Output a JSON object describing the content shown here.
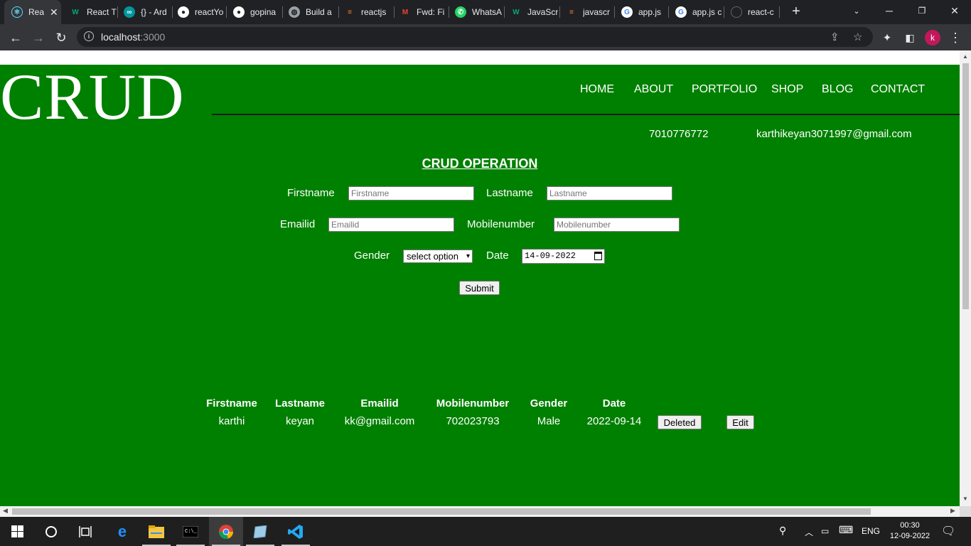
{
  "browser": {
    "tabs": [
      {
        "title": "Rea",
        "icon": "react-icon",
        "color": "#61dafb"
      },
      {
        "title": "React T",
        "icon": "w3schools-icon",
        "color": "#04aa6d"
      },
      {
        "title": "{} - Ard",
        "icon": "arduino-icon",
        "color": "#00979c"
      },
      {
        "title": "reactYo",
        "icon": "github-icon",
        "color": "#ffffff"
      },
      {
        "title": "gopina",
        "icon": "github-icon",
        "color": "#ffffff"
      },
      {
        "title": "Build a",
        "icon": "globe-icon",
        "color": "#9aa0a6"
      },
      {
        "title": "reactjs",
        "icon": "stackoverflow-icon",
        "color": "#f48024"
      },
      {
        "title": "Fwd: Fi",
        "icon": "gmail-icon",
        "color": "#ea4335"
      },
      {
        "title": "WhatsA",
        "icon": "whatsapp-icon",
        "color": "#25d366"
      },
      {
        "title": "JavaScr",
        "icon": "w3schools-icon",
        "color": "#04aa6d"
      },
      {
        "title": "javascr",
        "icon": "stackoverflow-icon",
        "color": "#f48024"
      },
      {
        "title": "app.js",
        "icon": "google-icon",
        "color": "#4285f4"
      },
      {
        "title": "app.js c",
        "icon": "google-icon",
        "color": "#4285f4"
      },
      {
        "title": "react-c",
        "icon": "loading-icon",
        "color": "#5f6368"
      }
    ],
    "url_host": "localhost",
    "url_port": ":3000",
    "profile_initial": "k"
  },
  "site": {
    "logo": "CRUD",
    "nav": [
      "HOME",
      "ABOUT",
      "PORTFOLIO",
      "SHOP",
      "BLOG",
      "CONTACT"
    ],
    "phone": "7010776772",
    "email": "karthikeyan3071997@gmail.com"
  },
  "form": {
    "heading": "CRUD OPERATION",
    "firstname_label": "Firstname",
    "firstname_placeholder": "Firstname",
    "lastname_label": "Lastname",
    "lastname_placeholder": "Lastname",
    "emailid_label": "Emailid",
    "emailid_placeholder": "Emailid",
    "mobile_label": "Mobilenumber",
    "mobile_placeholder": "Mobilenumber",
    "gender_label": "Gender",
    "gender_selected": "select option",
    "date_label": "Date",
    "date_value": "14-09-2022",
    "submit_label": "Submit"
  },
  "table": {
    "headers": [
      "Firstname",
      "Lastname",
      "Emailid",
      "Mobilenumber",
      "Gender",
      "Date"
    ],
    "rows": [
      {
        "cells": [
          "karthi",
          "keyan",
          "kk@gmail.com",
          "702023793",
          "Male",
          "2022-09-14"
        ],
        "delete_label": "Deleted",
        "edit_label": "Edit"
      }
    ]
  },
  "taskbar": {
    "time": "00:30",
    "date": "12-09-2022",
    "language": "ENG"
  }
}
